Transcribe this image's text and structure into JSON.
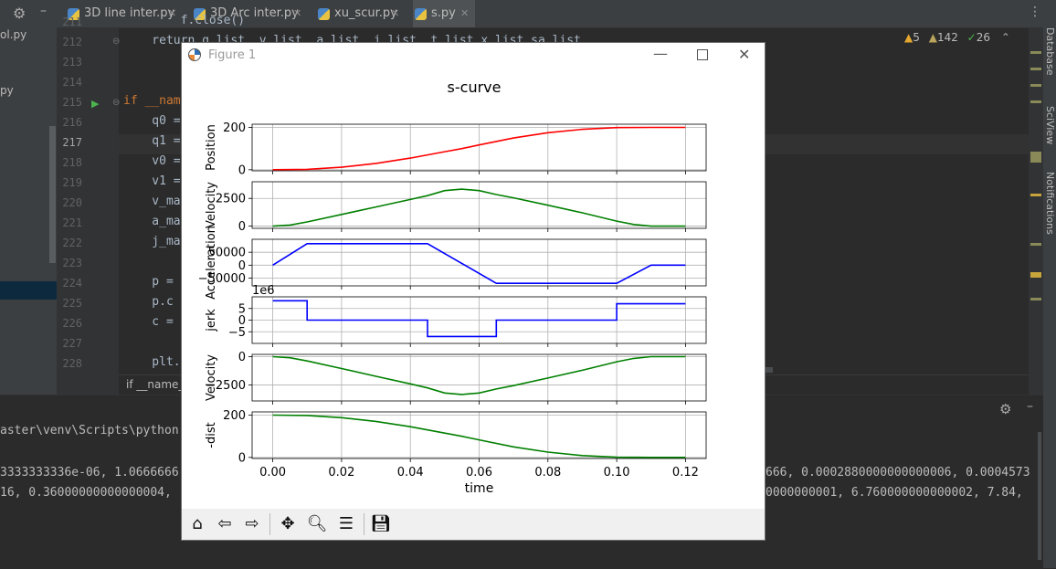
{
  "ide": {
    "tabs": [
      {
        "label": "3D line inter.py"
      },
      {
        "label": "3D Arc inter.py"
      },
      {
        "label": "xu_scur.py"
      },
      {
        "label": "s.py"
      }
    ],
    "project_items": [
      "ol.py",
      "py"
    ],
    "status": {
      "warnings": "5",
      "weak_warnings": "142",
      "ok": "26"
    },
    "right_tools": [
      "Database",
      "SciView",
      "Notifications"
    ],
    "line_numbers": [
      "211",
      "212",
      "213",
      "214",
      "215",
      "216",
      "217",
      "218",
      "219",
      "220",
      "221",
      "222",
      "223",
      "224",
      "225",
      "226",
      "227",
      "228"
    ],
    "code_lines": [
      "        f.close()",
      "    return q_list, v_list, a_list, j_list, t_list,x_list,sa_list",
      "",
      "",
      "if __name__ == '__main__':",
      "    q0 = ",
      "    q1 = ",
      "    v0 = ",
      "    v1 = ",
      "    v_ma",
      "    a_ma",
      "    j_ma",
      "",
      "    p = ",
      "    p.c",
      "    c = ",
      "",
      "    plt."
    ],
    "breadcrumb": "if __name__",
    "terminal": {
      "lines": [
        "aster\\venv\\Scripts\\python",
        "3333333336e-06, 1.0666666",
        "16, 0.36000000000000004, ",
        ""
      ],
      "right_lines": [
        "666, 0.0002880000000000006, 0.0004573",
        "0000000001, 6.760000000000002, 7.84, "
      ]
    }
  },
  "figure": {
    "window_title": "Figure 1",
    "suptitle": "s-curve",
    "toolbar": [
      "home-icon",
      "back-icon",
      "forward-icon",
      "pan-icon",
      "zoom-icon",
      "configure-icon",
      "save-icon"
    ]
  },
  "chart_data": [
    {
      "type": "line",
      "ylabel": "Position",
      "color": "#ff0000",
      "xlim": [
        -0.006,
        0.126
      ],
      "ylim": [
        -5,
        215
      ],
      "yticks": [
        {
          "v": 0,
          "label": "0"
        },
        {
          "v": 200,
          "label": "200"
        }
      ],
      "x": [
        0,
        0.01,
        0.02,
        0.03,
        0.04,
        0.05,
        0.055,
        0.06,
        0.07,
        0.08,
        0.09,
        0.1,
        0.11,
        0.12
      ],
      "y": [
        0,
        2,
        12,
        30,
        55,
        85,
        100,
        117,
        150,
        175,
        191,
        199,
        200,
        200
      ]
    },
    {
      "type": "line",
      "ylabel": "Velocity",
      "color": "#008000",
      "xlim": [
        -0.006,
        0.126
      ],
      "ylim": [
        -200,
        4000
      ],
      "yticks": [
        {
          "v": 0,
          "label": "0"
        },
        {
          "v": 2500,
          "label": "2500"
        }
      ],
      "x": [
        0,
        0.005,
        0.01,
        0.02,
        0.03,
        0.04,
        0.045,
        0.05,
        0.055,
        0.06,
        0.065,
        0.07,
        0.08,
        0.09,
        0.1,
        0.105,
        0.11,
        0.12
      ],
      "y": [
        0,
        100,
        380,
        1050,
        1730,
        2400,
        2750,
        3200,
        3330,
        3200,
        2850,
        2550,
        1880,
        1200,
        450,
        150,
        0,
        0
      ]
    },
    {
      "type": "line",
      "ylabel": "Acceleration",
      "color": "#0000ff",
      "xlim": [
        -0.006,
        0.126
      ],
      "ylim": [
        -80000,
        100000
      ],
      "yticks": [
        {
          "v": 50000,
          "label": "50000"
        },
        {
          "v": 0,
          "label": "0"
        },
        {
          "v": -50000,
          "label": "−50000"
        }
      ],
      "x": [
        0,
        0.01,
        0.045,
        0.065,
        0.1,
        0.11,
        0.12
      ],
      "y": [
        0,
        83000,
        83000,
        -70000,
        -70000,
        0,
        0
      ]
    },
    {
      "type": "line",
      "ylabel": "jerk",
      "offset_label": "1e6",
      "color": "#0000ff",
      "xlim": [
        -0.006,
        0.126
      ],
      "ylim": [
        -10,
        10
      ],
      "yticks": [
        {
          "v": 5,
          "label": "5"
        },
        {
          "v": 0,
          "label": "0"
        },
        {
          "v": -5,
          "label": "−5"
        }
      ],
      "x": [
        0,
        0.01,
        0.01,
        0.045,
        0.045,
        0.065,
        0.065,
        0.1,
        0.1,
        0.12
      ],
      "y": [
        8.3,
        8.3,
        0,
        0,
        -7,
        -7,
        0,
        0,
        7,
        7
      ]
    },
    {
      "type": "line",
      "ylabel": "Velocity",
      "color": "#008000",
      "xlim": [
        -0.006,
        0.126
      ],
      "ylim": [
        -3900,
        200
      ],
      "yticks": [
        {
          "v": 0,
          "label": "0"
        },
        {
          "v": -2500,
          "label": "−2500"
        }
      ],
      "x": [
        0,
        0.005,
        0.01,
        0.02,
        0.03,
        0.04,
        0.045,
        0.05,
        0.055,
        0.06,
        0.065,
        0.07,
        0.08,
        0.09,
        0.1,
        0.105,
        0.11,
        0.12
      ],
      "y": [
        0,
        -100,
        -380,
        -1050,
        -1730,
        -2400,
        -2750,
        -3200,
        -3330,
        -3200,
        -2850,
        -2550,
        -1880,
        -1200,
        -450,
        -150,
        0,
        0
      ]
    },
    {
      "type": "line",
      "ylabel": "-dist",
      "xlabel": "time",
      "color": "#008000",
      "xlim": [
        -0.006,
        0.126
      ],
      "ylim": [
        -5,
        215
      ],
      "yticks": [
        {
          "v": 0,
          "label": "0"
        },
        {
          "v": 200,
          "label": "200"
        }
      ],
      "xticks": [
        {
          "v": 0,
          "label": "0.00"
        },
        {
          "v": 0.02,
          "label": "0.02"
        },
        {
          "v": 0.04,
          "label": "0.04"
        },
        {
          "v": 0.06,
          "label": "0.06"
        },
        {
          "v": 0.08,
          "label": "0.08"
        },
        {
          "v": 0.1,
          "label": "0.10"
        },
        {
          "v": 0.12,
          "label": "0.12"
        }
      ],
      "x": [
        0,
        0.01,
        0.02,
        0.03,
        0.04,
        0.05,
        0.055,
        0.06,
        0.07,
        0.08,
        0.09,
        0.1,
        0.11,
        0.12
      ],
      "y": [
        200,
        198,
        188,
        170,
        145,
        115,
        100,
        83,
        50,
        25,
        9,
        1,
        0,
        0
      ]
    }
  ]
}
